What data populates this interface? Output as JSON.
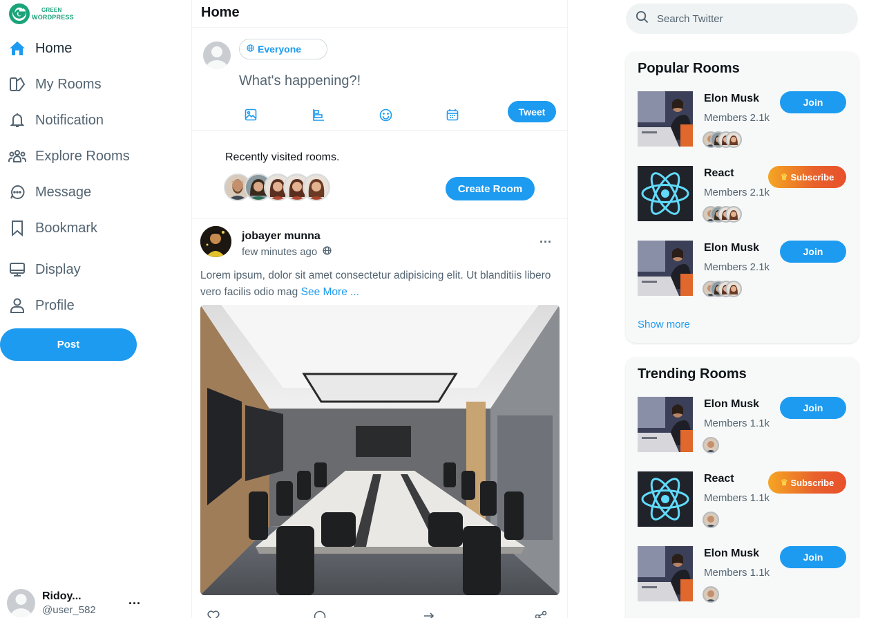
{
  "brand": {
    "line1": "GREEN",
    "line2": "WORDPRESS"
  },
  "nav": [
    {
      "label": "Home",
      "icon": "home-icon"
    },
    {
      "label": "My Rooms",
      "icon": "rooms-icon"
    },
    {
      "label": "Notification",
      "icon": "bell-icon"
    },
    {
      "label": "Explore Rooms",
      "icon": "people-icon"
    },
    {
      "label": "Message",
      "icon": "message-icon"
    },
    {
      "label": "Bookmark",
      "icon": "bookmark-icon"
    },
    {
      "label": "Display",
      "icon": "monitor-icon"
    },
    {
      "label": "Profile",
      "icon": "user-icon"
    }
  ],
  "post_button": "Post",
  "account": {
    "name": "Ridoy...",
    "handle": "@user_582",
    "more": "..."
  },
  "feed": {
    "title": "Home",
    "composer": {
      "audience": "Everyone",
      "placeholder": "What's happening?!",
      "tweet_label": "Tweet"
    },
    "recent": {
      "title": "Recently visited rooms.",
      "create_label": "Create Room"
    },
    "post": {
      "author": "jobayer munna",
      "time": "few minutes ago",
      "text": "Lorem ipsum, dolor sit amet consectetur adipisicing elit. Ut blanditiis libero vero facilis odio mag",
      "see_more": "See More ...",
      "more": "..."
    }
  },
  "search": {
    "placeholder": "Search Twitter"
  },
  "popular": {
    "title": "Popular Rooms",
    "rooms": [
      {
        "name": "Elon Musk",
        "members": "Members 2.1k",
        "action": "Join"
      },
      {
        "name": "React",
        "members": "Members 2.1k",
        "action": "Subscribe"
      },
      {
        "name": "Elon Musk",
        "members": "Members 2.1k",
        "action": "Join"
      }
    ],
    "show_more": "Show more"
  },
  "trending": {
    "title": "Trending Rooms",
    "rooms": [
      {
        "name": "Elon Musk",
        "members": "Members 1.1k",
        "action": "Join"
      },
      {
        "name": "React",
        "members": "Members 1.1k",
        "action": "Subscribe"
      },
      {
        "name": "Elon Musk",
        "members": "Members 1.1k",
        "action": "Join"
      }
    ]
  },
  "colors": {
    "accent": "#1d9bf0",
    "brand": "#1ba37a",
    "subscribe_from": "#f5a623",
    "subscribe_to": "#e8502c",
    "react_bg": "#20232a",
    "react_logo": "#61dafb"
  }
}
